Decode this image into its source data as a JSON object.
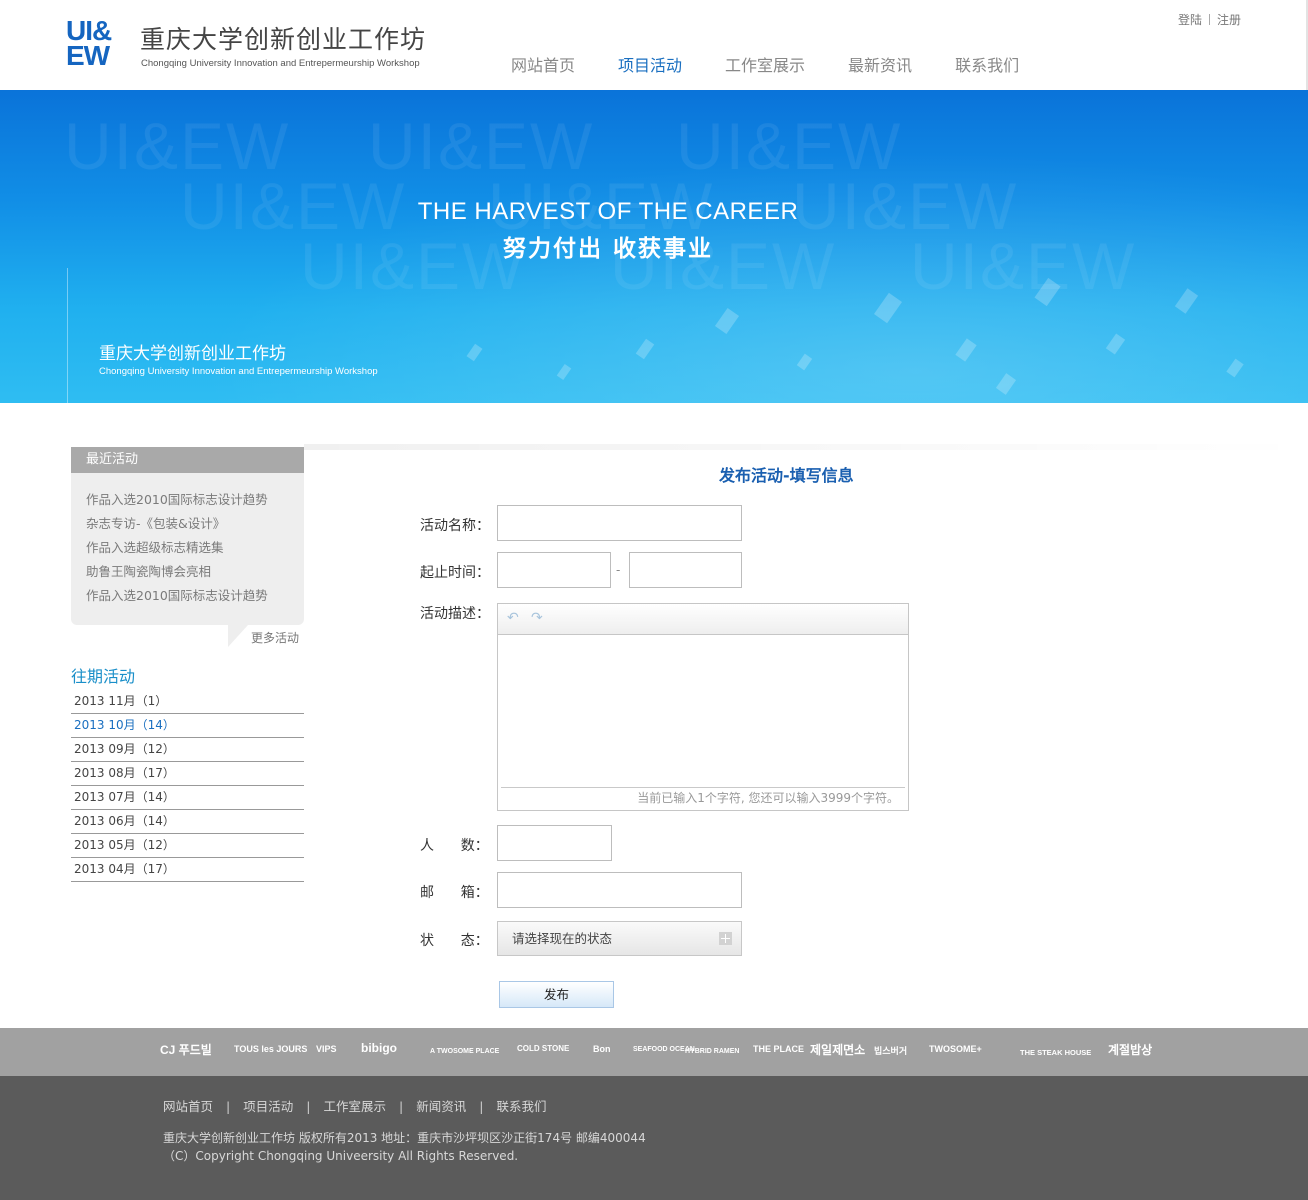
{
  "header": {
    "logo_line1": "UI&",
    "logo_line2": "EW",
    "logo_cn": "重庆大学创新创业工作坊",
    "logo_en": "Chongqing University Innovation and Entrepermeurship Workshop",
    "login": "登陆",
    "register": "注册",
    "nav": [
      {
        "label": "网站首页"
      },
      {
        "label": "项目活动",
        "active": true
      },
      {
        "label": "工作室展示"
      },
      {
        "label": "最新资讯"
      },
      {
        "label": "联系我们"
      }
    ],
    "accent_color": "#1a6fc0"
  },
  "banner": {
    "title_en": "THE HARVEST OF THE CAREER",
    "title_cn": "努力付出 收获事业",
    "org_cn": "重庆大学创新创业工作坊",
    "org_en": "Chongqing University Innovation and Entrepermeurship Workshop",
    "watermark": "UI&EW"
  },
  "sidebar": {
    "recent_title": "最近活动",
    "recent_items": [
      "作品入选2010国际标志设计趋势",
      "杂志专访-《包装&设计》",
      "作品入选超级标志精选集",
      "助鲁王陶瓷陶博会亮相",
      "作品入选2010国际标志设计趋势"
    ],
    "more": "更多活动",
    "archive_title": "往期活动",
    "archive": [
      {
        "label": "2013 11月（1）"
      },
      {
        "label": "2013 10月（14）",
        "active": true
      },
      {
        "label": "2013 09月（12）"
      },
      {
        "label": "2013 08月（17）"
      },
      {
        "label": "2013 07月（14）"
      },
      {
        "label": "2013 06月（14）"
      },
      {
        "label": "2013 05月（12）"
      },
      {
        "label": "2013 04月（17）"
      }
    ]
  },
  "form": {
    "title": "发布活动-填写信息",
    "name_label": "活动名称：",
    "name_value": "",
    "time_label": "起止时间：",
    "time_start": "",
    "time_end": "",
    "time_sep": "-",
    "desc_label": "活动描述：",
    "undo_icon": "undo-icon",
    "redo_icon": "redo-icon",
    "desc_value": "",
    "desc_counter": "当前已输入1个字符, 您还可以输入3999个字符。",
    "people_label": "人      数：",
    "people_value": "",
    "email_label": "邮      箱：",
    "email_value": "",
    "status_label": "状      态：",
    "status_value": "请选择现在的状态",
    "submit": "发布"
  },
  "footer": {
    "brands": [
      "CJ 푸드빌",
      "TOUS les JOURS",
      "VIPS",
      "bibigo",
      "A TWOSOME PLACE",
      "COLD STONE",
      "Bon",
      "SEAFOOD OCEAN",
      "HYBRID RAMEN",
      "THE PLACE",
      "제일제면소",
      "빕스버거",
      "TWOSOME+",
      "THE STEAK HOUSE",
      "계절밥상"
    ],
    "nav": [
      "网站首页",
      "项目活动",
      "工作室展示",
      "新闻资讯",
      "联系我们"
    ],
    "copy1": "重庆大学创新创业工作坊 版权所有2013  地址：重庆市沙坪坝区沙正街174号  邮编400044",
    "copy2": "（C）Copyright Chongqing Univeersity All Rights Reserved."
  }
}
